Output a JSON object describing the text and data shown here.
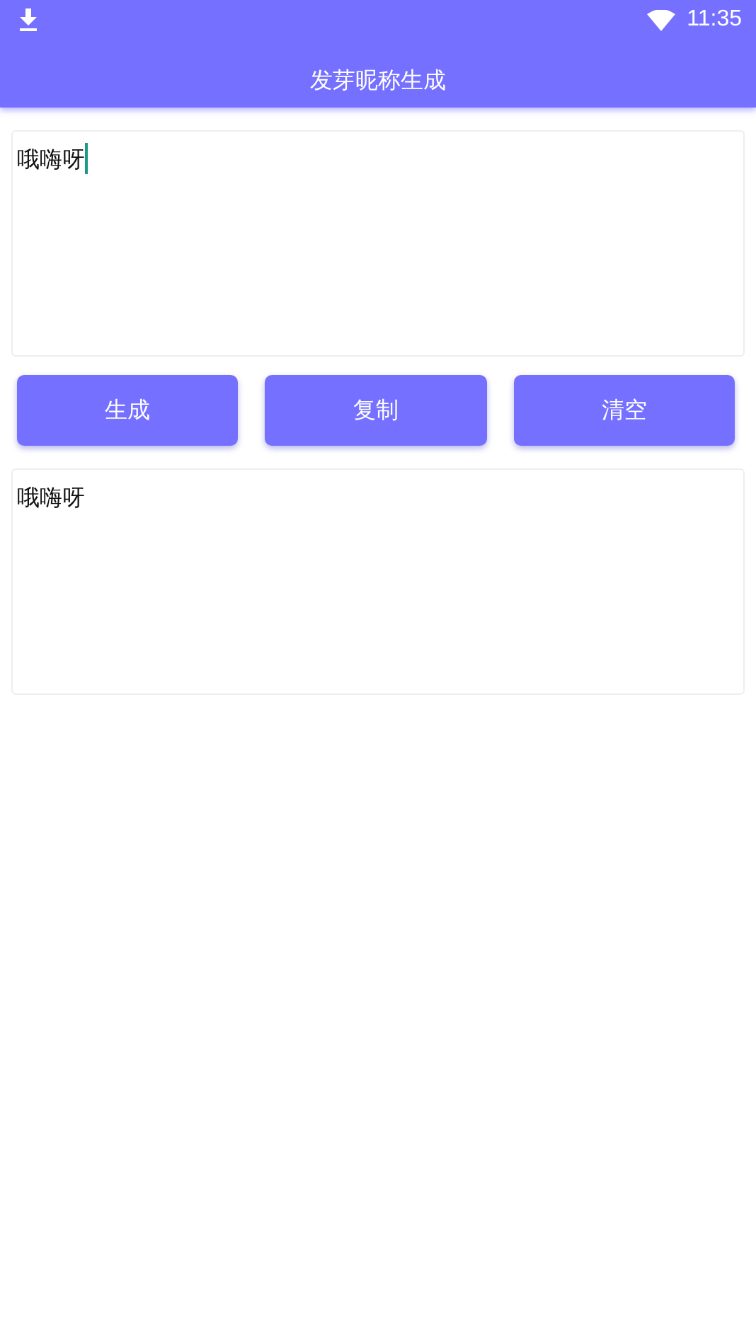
{
  "status_bar": {
    "time": "11:35"
  },
  "app_bar": {
    "title": "发芽昵称生成"
  },
  "input": {
    "value": "哦嗨呀",
    "focused": true
  },
  "buttons": [
    "生成",
    "复制",
    "清空"
  ],
  "output": {
    "value": "哦嗨呀"
  }
}
